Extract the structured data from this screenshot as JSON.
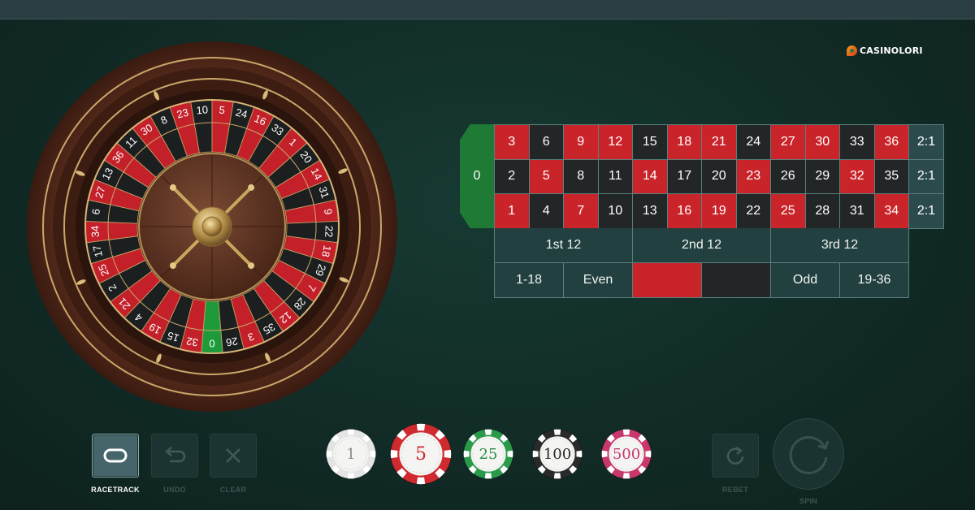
{
  "brand": {
    "name": "CASINOLORI"
  },
  "wheel": {
    "sequence": [
      "0",
      "32",
      "15",
      "19",
      "4",
      "21",
      "2",
      "25",
      "17",
      "34",
      "6",
      "27",
      "13",
      "36",
      "11",
      "30",
      "8",
      "23",
      "10",
      "5",
      "24",
      "16",
      "33",
      "1",
      "20",
      "14",
      "31",
      "9",
      "22",
      "18",
      "29",
      "7",
      "28",
      "12",
      "35",
      "3",
      "26"
    ],
    "zero_color": "#1f9a3a",
    "red_color": "#c3202a",
    "black_color": "#1c1f20"
  },
  "table": {
    "zero": "0",
    "rows": [
      [
        {
          "n": "3",
          "c": "red"
        },
        {
          "n": "6",
          "c": "black"
        },
        {
          "n": "9",
          "c": "red"
        },
        {
          "n": "12",
          "c": "red"
        },
        {
          "n": "15",
          "c": "black"
        },
        {
          "n": "18",
          "c": "red"
        },
        {
          "n": "21",
          "c": "red"
        },
        {
          "n": "24",
          "c": "black"
        },
        {
          "n": "27",
          "c": "red"
        },
        {
          "n": "30",
          "c": "red"
        },
        {
          "n": "33",
          "c": "black"
        },
        {
          "n": "36",
          "c": "red"
        },
        {
          "n": "2:1",
          "c": "col"
        }
      ],
      [
        {
          "n": "2",
          "c": "black"
        },
        {
          "n": "5",
          "c": "red"
        },
        {
          "n": "8",
          "c": "black"
        },
        {
          "n": "11",
          "c": "black"
        },
        {
          "n": "14",
          "c": "red"
        },
        {
          "n": "17",
          "c": "black"
        },
        {
          "n": "20",
          "c": "black"
        },
        {
          "n": "23",
          "c": "red"
        },
        {
          "n": "26",
          "c": "black"
        },
        {
          "n": "29",
          "c": "black"
        },
        {
          "n": "32",
          "c": "red"
        },
        {
          "n": "35",
          "c": "black"
        },
        {
          "n": "2:1",
          "c": "col"
        }
      ],
      [
        {
          "n": "1",
          "c": "red"
        },
        {
          "n": "4",
          "c": "black"
        },
        {
          "n": "7",
          "c": "red"
        },
        {
          "n": "10",
          "c": "black"
        },
        {
          "n": "13",
          "c": "black"
        },
        {
          "n": "16",
          "c": "red"
        },
        {
          "n": "19",
          "c": "red"
        },
        {
          "n": "22",
          "c": "black"
        },
        {
          "n": "25",
          "c": "red"
        },
        {
          "n": "28",
          "c": "black"
        },
        {
          "n": "31",
          "c": "black"
        },
        {
          "n": "34",
          "c": "red"
        },
        {
          "n": "2:1",
          "c": "col"
        }
      ]
    ],
    "dozens": [
      "1st 12",
      "2nd 12",
      "3rd 12"
    ],
    "outside": [
      {
        "label": "1-18",
        "kind": "plain"
      },
      {
        "label": "Even",
        "kind": "plain"
      },
      {
        "label": "",
        "kind": "redfield"
      },
      {
        "label": "",
        "kind": "blackfield"
      },
      {
        "label": "Odd",
        "kind": "plain"
      },
      {
        "label": "19-36",
        "kind": "plain"
      }
    ]
  },
  "controls": {
    "racetrack": "RACETRACK",
    "undo": "UNDO",
    "clear": "CLEAR",
    "rebet": "REBET",
    "spin": "SPIN"
  },
  "chips": [
    {
      "value": "1",
      "color": "#e4e4e4",
      "stripe": "#ffffff",
      "text": "#8a8a8a",
      "selected": false
    },
    {
      "value": "5",
      "color": "#cf2a30",
      "stripe": "#ffffff",
      "text": "#cf2a30",
      "selected": true
    },
    {
      "value": "25",
      "color": "#2a9a4a",
      "stripe": "#ffffff",
      "text": "#2a8a45",
      "selected": false
    },
    {
      "value": "100",
      "color": "#2a2a2a",
      "stripe": "#ffffff",
      "text": "#2a2a2a",
      "selected": false
    },
    {
      "value": "500",
      "color": "#c9376c",
      "stripe": "#ffffff",
      "text": "#c9376c",
      "selected": false
    }
  ],
  "colors": {
    "background": "#13302a",
    "accent": "#88aaab"
  }
}
